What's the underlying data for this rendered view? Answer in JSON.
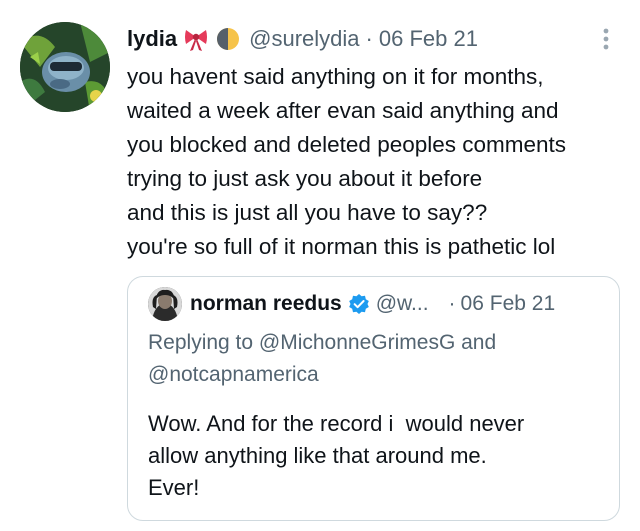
{
  "tweet": {
    "display_name": "lydia",
    "handle": "@surelydia",
    "separator": "·",
    "date": "06 Feb 21",
    "lines": [
      "you havent said anything on it for months,",
      "waited a week after evan said anything and",
      "you blocked and deleted peoples comments",
      "trying to just ask you about it before",
      "and this is just all you have to say??",
      "you're so full of it norman this is pathetic lol"
    ],
    "emoji": [
      "ribbon-emoji",
      "half-moon-emoji"
    ]
  },
  "quote": {
    "display_name": "norman reedus",
    "handle": "@w...",
    "separator": "·",
    "date": "06 Feb 21",
    "reply_prefix": "Replying to",
    "reply_line1_users": "@MichonneGrimesG",
    "reply_and": "and",
    "reply_line2": "@notcapnamerica",
    "body_lines": [
      "Wow. And for the record i  would never",
      "allow anything like that around me.",
      "Ever!"
    ]
  },
  "colors": {
    "text": "#0f1419",
    "muted": "#536471",
    "verified": "#1d9bf0",
    "border": "#cfd9de"
  }
}
